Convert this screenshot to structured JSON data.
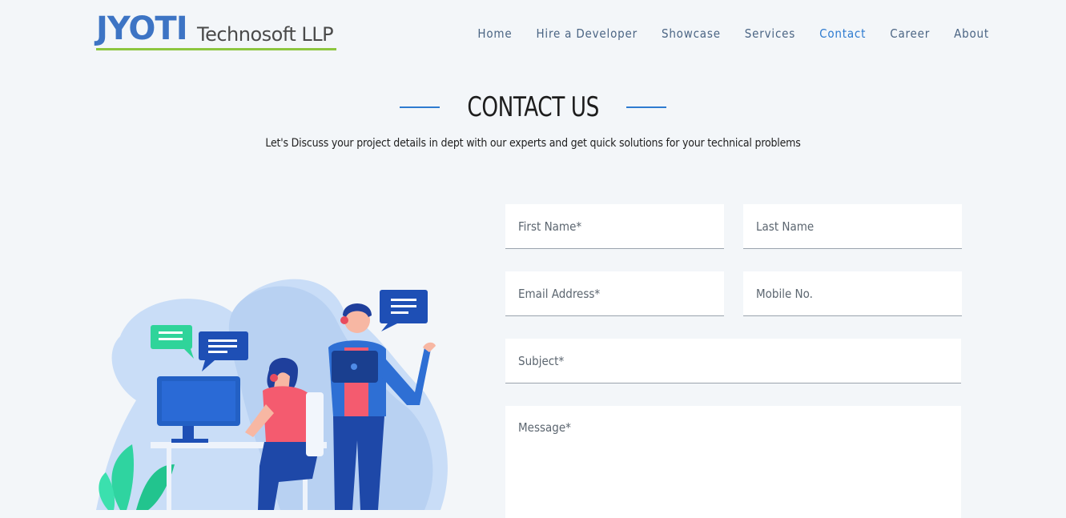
{
  "header": {
    "logo_main": "JYOTI",
    "logo_sub": "Technosoft LLP",
    "nav": [
      {
        "label": "Home",
        "active": false
      },
      {
        "label": "Hire a Developer",
        "active": false
      },
      {
        "label": "Showcase",
        "active": false
      },
      {
        "label": "Services",
        "active": false
      },
      {
        "label": "Contact",
        "active": true
      },
      {
        "label": "Career",
        "active": false
      },
      {
        "label": "About",
        "active": false
      }
    ]
  },
  "page": {
    "title": "CONTACT US",
    "subtitle": "Let's Discuss your project details in dept with our experts and get quick solutions for your technical problems"
  },
  "form": {
    "first_name_placeholder": "First Name*",
    "last_name_placeholder": "Last Name",
    "email_placeholder": "Email Address*",
    "mobile_placeholder": "Mobile No.",
    "subject_placeholder": "Subject*",
    "message_placeholder": "Message*"
  },
  "colors": {
    "accent": "#2e7bd0",
    "logo_blue": "#3d74c4",
    "logo_green": "#8dc63f",
    "background": "#f3f6f9"
  }
}
